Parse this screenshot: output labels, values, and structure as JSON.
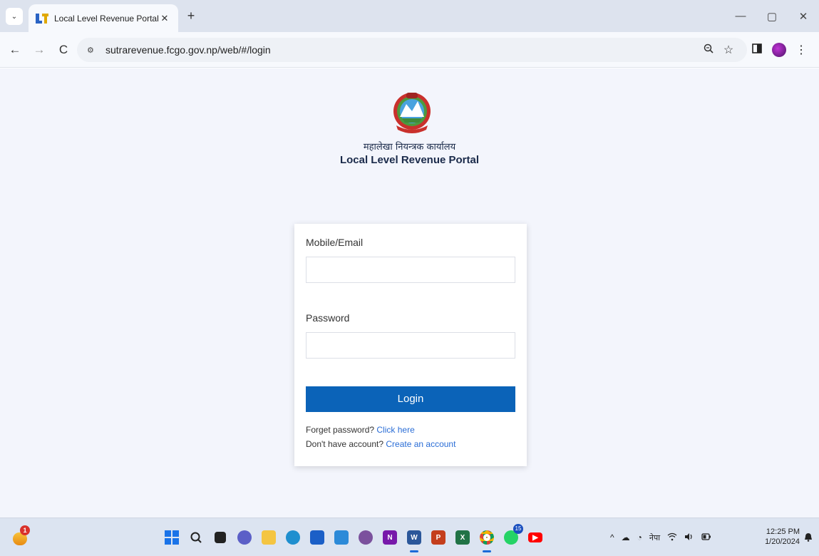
{
  "browser": {
    "tab": {
      "title": "Local Level Revenue Portal",
      "close": "✕"
    },
    "new_tab": "+",
    "window_controls": {
      "minimize": "—",
      "restore": "▢",
      "close": "✕"
    },
    "nav": {
      "back": "←",
      "forward": "→",
      "reload": "C"
    },
    "address": {
      "url": "sutrarevenue.fcgo.gov.np/web/#/login",
      "site_info": "⚙"
    },
    "icons": [
      "zoom-icon",
      "bookmark-star-icon",
      "side-panel-icon",
      "profile-avatar",
      "menu-kebab-icon"
    ]
  },
  "page": {
    "org_name": "महालेखा नियन्त्रक कार्यालय",
    "portal_name": "Local Level Revenue Portal",
    "login": {
      "mobile_label": "Mobile/Email",
      "mobile_value": "",
      "password_label": "Password",
      "password_value": "",
      "login_button": "Login",
      "forget_prefix": "Forget password?",
      "forget_link": "Click here",
      "account_prefix": "Don't have account?",
      "account_link": "Create an account"
    }
  },
  "taskbar": {
    "weather_badge": "1",
    "whatsapp_badge": "15",
    "tray_language": "नेपा",
    "clock_time": "12:25 PM",
    "clock_date": "1/20/2024"
  },
  "colors": {
    "primary_button": "#0b63b8",
    "link": "#2a6dd6",
    "page_background": "#f3f5fc"
  }
}
